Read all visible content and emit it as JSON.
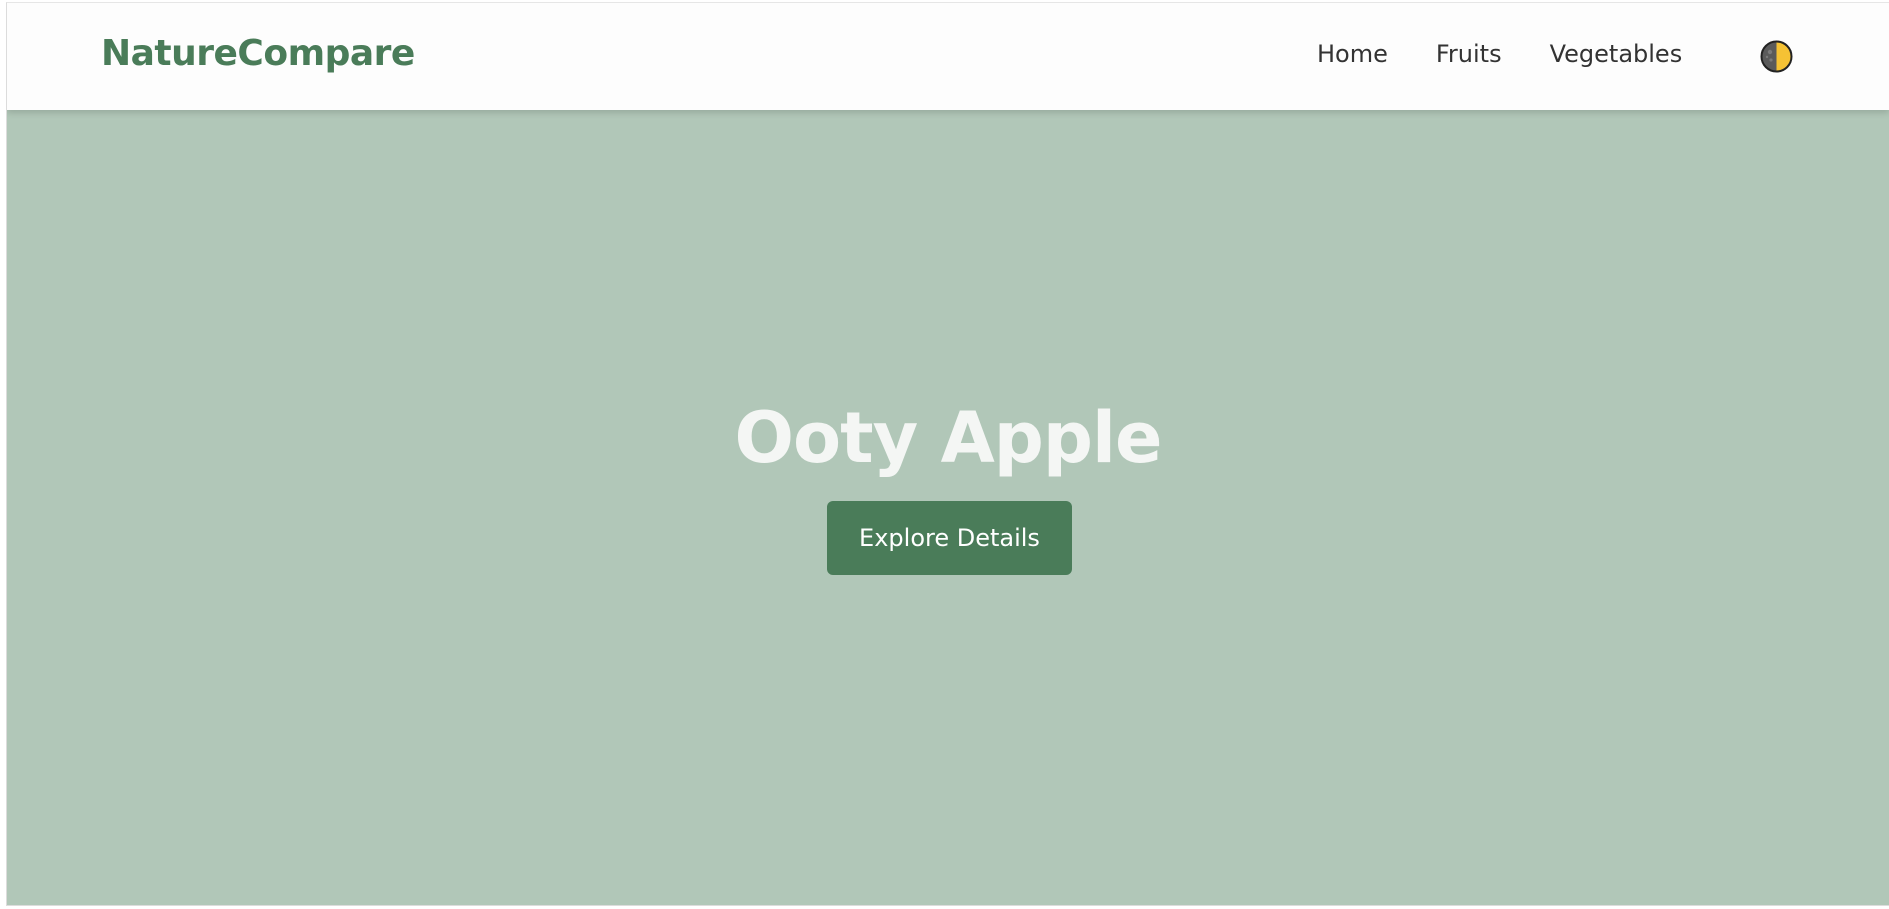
{
  "brand": {
    "name": "NatureCompare",
    "color": "#4a7c59"
  },
  "nav": {
    "items": [
      {
        "label": "Home"
      },
      {
        "label": "Fruits"
      },
      {
        "label": "Vegetables"
      }
    ],
    "theme_toggle_icon": "half-moon-theme-icon"
  },
  "hero": {
    "title": "Ooty Apple",
    "button_label": "Explore Details",
    "background_color": "#b1c7b8",
    "button_color": "#4a7c59"
  }
}
